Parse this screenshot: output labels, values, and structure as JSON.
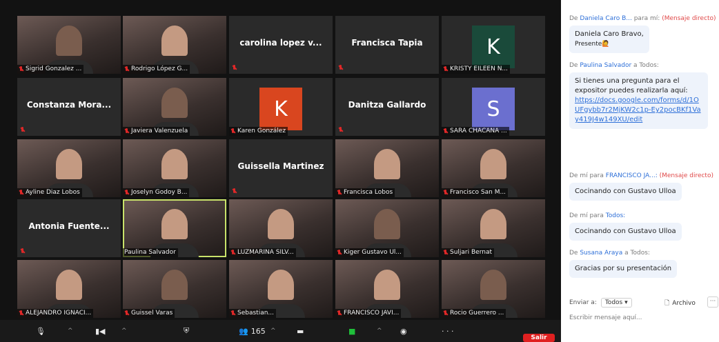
{
  "tiles": [
    {
      "kind": "photo",
      "name": "Sigrid Gonzalez ..."
    },
    {
      "kind": "photo",
      "name": "Rodrigo López G..."
    },
    {
      "kind": "text",
      "center": "carolina lopez v..."
    },
    {
      "kind": "text",
      "center": "Francisca Tapia"
    },
    {
      "kind": "avatar",
      "letter": "K",
      "avatar_color": "#1a4a3a",
      "name": "KRISTY EILEEN N..."
    },
    {
      "kind": "text",
      "center": "Constanza Mora..."
    },
    {
      "kind": "photo",
      "name": "Javiera Valenzuela"
    },
    {
      "kind": "avatar",
      "letter": "K",
      "avatar_color": "#d9461f",
      "name": "Karen González"
    },
    {
      "kind": "text",
      "center": "Danitza Gallardo"
    },
    {
      "kind": "avatar",
      "letter": "S",
      "avatar_color": "#6b6fcf",
      "name": "SARA CHACANA ..."
    },
    {
      "kind": "photo",
      "name": "Ayline Diaz Lobos"
    },
    {
      "kind": "photo",
      "name": "Joselyn Godoy B..."
    },
    {
      "kind": "text",
      "center": "Guissella Martinez"
    },
    {
      "kind": "photo",
      "name": "Francisca Lobos"
    },
    {
      "kind": "photo",
      "name": "Francisco San M..."
    },
    {
      "kind": "text",
      "center": "Antonia Fuente..."
    },
    {
      "kind": "photo",
      "name": "Paulina Salvador",
      "active": true
    },
    {
      "kind": "photo",
      "name": "LUZMARINA SILV..."
    },
    {
      "kind": "photo",
      "name": "Kiger Gustavo Ul..."
    },
    {
      "kind": "photo",
      "name": "Suljari Bernat"
    },
    {
      "kind": "photo",
      "name": "ALEJANDRO IGNACI..."
    },
    {
      "kind": "photo",
      "name": "Guissel Varas"
    },
    {
      "kind": "photo",
      "name": "Sebastian..."
    },
    {
      "kind": "photo",
      "name": "FRANCISCO JAVI..."
    },
    {
      "kind": "photo",
      "name": "Rocio Guerrero ..."
    }
  ],
  "toolbar": {
    "participants_count": "165",
    "leave_label": "Salir",
    "dots": "· · ·"
  },
  "chat": {
    "messages": [
      {
        "from": "De",
        "user": "Daniela Caro B...",
        "to": "para mí:",
        "tag": "(Mensaje directo)",
        "text": "Daniela Caro Bravo,",
        "text2": "Presente🙋"
      },
      {
        "from": "De",
        "user": "Paulina Salvador",
        "to": "a Todos:",
        "text": "Si tienes una pregunta para el expositor puedes realizarla aquí:",
        "link": "https://docs.google.com/forms/d/1OUFgybb7r2MjKW2c1p-Ey2pocBKf1Vay419J4w149XU/edit"
      },
      {
        "from": "De mí para",
        "user": "FRANCISCO JA...:",
        "tag": "(Mensaje directo)",
        "text": "Cocinando con Gustavo Ulloa"
      },
      {
        "from": "De mí para",
        "user": "Todos:",
        "text": "Cocinando con Gustavo Ulloa"
      },
      {
        "from": "De",
        "user": "Susana Araya",
        "to": "a Todos:",
        "text": "Gracias por su presentación"
      }
    ],
    "send_to_label": "Enviar a:",
    "send_to_value": "Todos ▾",
    "file_label": "Archivo",
    "more_label": "···",
    "input_placeholder": "Escribir mensaje aquí..."
  }
}
